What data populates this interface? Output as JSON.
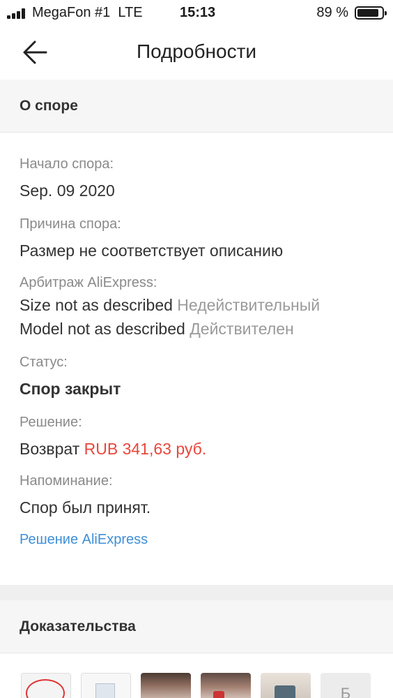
{
  "status_bar": {
    "carrier": "MegaFon #1",
    "network": "LTE",
    "time": "15:13",
    "battery": "89 %",
    "battery_level": 0.89
  },
  "nav": {
    "back_icon": "arrow-left-icon",
    "title": "Подробности"
  },
  "dispute_section": {
    "title": "О споре"
  },
  "fields": {
    "start_label": "Начало спора:",
    "start_value": "Sep. 09 2020",
    "reason_label": "Причина спора:",
    "reason_value": "Размер не соответствует описанию",
    "arbitration_label": "Арбитраж AliExpress:",
    "arbitration_items": [
      {
        "claim": "Size not as described",
        "verdict": "Недействительный"
      },
      {
        "claim": "Model not as described",
        "verdict": "Действителен"
      }
    ],
    "status_label": "Статус:",
    "status_value": "Спор закрыт",
    "decision_label": "Решение:",
    "decision_prefix": "Возврат",
    "decision_amount": "RUB 341,63 руб.",
    "reminder_label": "Напоминание:",
    "reminder_value": "Спор был принят.",
    "decision_link": "Решение AliExpress"
  },
  "evidence_section": {
    "title": "Доказательства",
    "partial_text": "Б"
  },
  "colors": {
    "price": "#e8473c",
    "link": "#3f8fd8",
    "section_bg": "#f6f6f6"
  }
}
